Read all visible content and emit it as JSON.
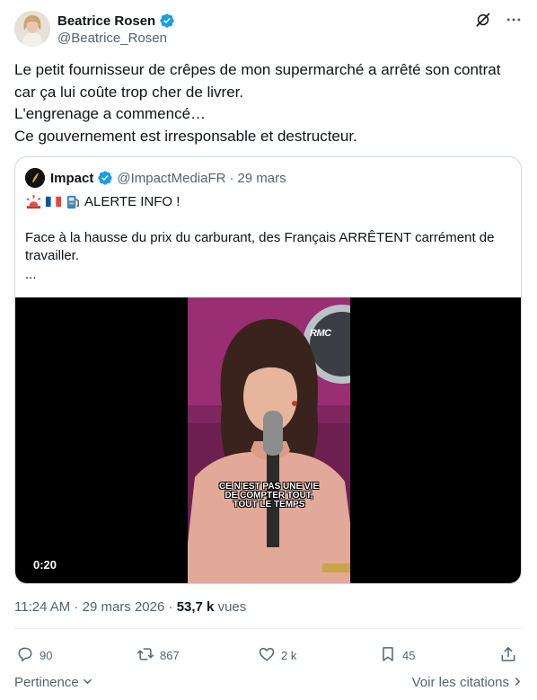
{
  "author": {
    "name": "Beatrice Rosen",
    "handle": "@Beatrice_Rosen"
  },
  "tweet": {
    "lines": [
      "Le petit fournisseur de crêpes de mon supermarché a arrêté son contrat",
      "car ça lui coûte trop cher de livrer.",
      "L'engrenage a commencé…",
      "Ce gouvernement est irresponsable et destructeur."
    ]
  },
  "quote": {
    "name": "Impact",
    "handle": "@ImpactMediaFR",
    "separator": "·",
    "date": "29 mars",
    "alert": "ALERTE INFO !",
    "body": "Face à la hausse du prix du carburant, des Français ARRÊTENT carrément de travailler.",
    "ellipsis": "...",
    "video": {
      "channel_logo": "RMC",
      "caption_lines": [
        "CE N'EST PAS UNE VIE",
        "DE COMPTER TOUT,",
        "TOUT LE TEMPS"
      ],
      "duration": "0:20"
    }
  },
  "meta": {
    "time": "11:24 AM",
    "separator": "·",
    "date": "29 mars 2026",
    "views_count": "53,7 k",
    "views_label": "vues"
  },
  "actions": {
    "replies": "90",
    "reposts": "867",
    "likes": "2 k",
    "bookmarks": "45"
  },
  "footer": {
    "sort_label": "Pertinence",
    "quotes_link": "Voir les citations"
  },
  "colors": {
    "verified": "#1d9bf0",
    "secondary_text": "#536471",
    "border": "#cfd9de",
    "quote_verified": "#1d9bf0"
  },
  "icons": {
    "top_right": [
      "grok-icon",
      "more-icon"
    ],
    "action_bar": [
      "reply-icon",
      "repost-icon",
      "like-icon",
      "bookmark-icon",
      "share-icon"
    ],
    "quote_emoji": [
      "rotating-light-emoji",
      "france-flag-emoji",
      "fuel-pump-emoji"
    ]
  }
}
